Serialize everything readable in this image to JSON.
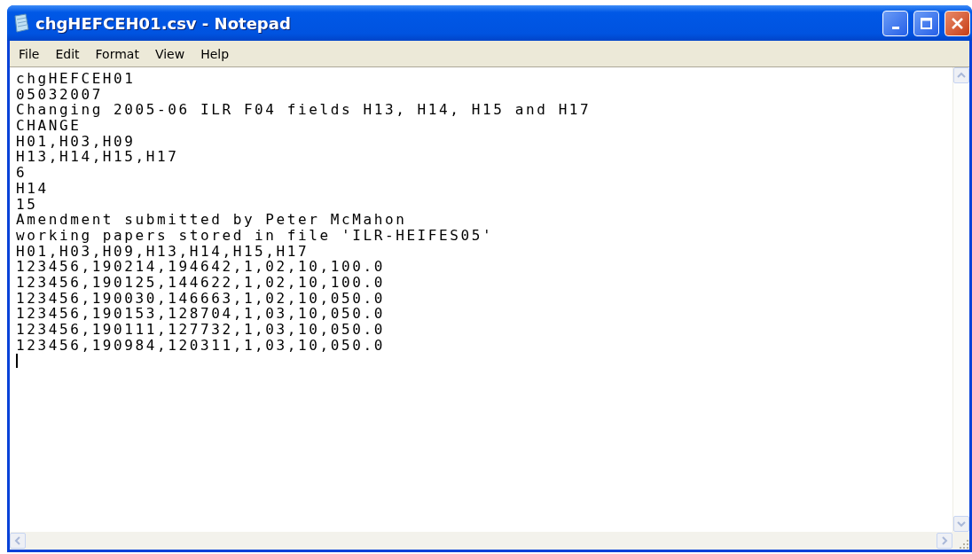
{
  "window": {
    "title": "chgHEFCEH01.csv - Notepad"
  },
  "menu": [
    "File",
    "Edit",
    "Format",
    "View",
    "Help"
  ],
  "lines": [
    "chgHEFCEH01",
    "05032007",
    "Changing 2005-06 ILR F04 fields H13, H14, H15 and H17",
    "CHANGE",
    "H01,H03,H09",
    "H13,H14,H15,H17",
    "6",
    "H14",
    "15",
    "Amendment submitted by Peter McMahon",
    "working papers stored in file 'ILR-HEIFES05'",
    "H01,H03,H09,H13,H14,H15,H17",
    "123456,190214,194642,1,02,10,100.0",
    "123456,190125,144622,1,02,10,100.0",
    "123456,190030,146663,1,02,10,050.0",
    "123456,190153,128704,1,03,10,050.0",
    "123456,190111,127732,1,03,10,050.0",
    "123456,190984,120311,1,03,10,050.0"
  ]
}
